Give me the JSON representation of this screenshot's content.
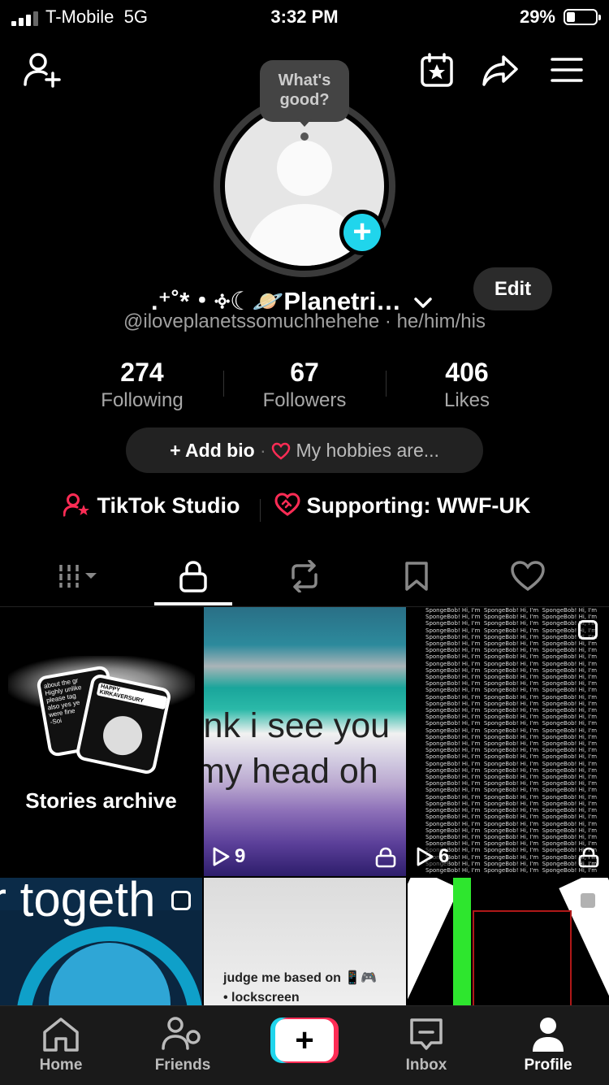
{
  "status_bar": {
    "carrier": "T-Mobile",
    "network": "5G",
    "time": "3:32 PM",
    "battery": "29%"
  },
  "bubble": {
    "line1": "What's",
    "line2": "good?"
  },
  "profile": {
    "display_name": ".⁺˚*・༓☾🪐Planetri…",
    "edit_label": "Edit",
    "handle": "@iloveplanetssomuchhehehe",
    "pronouns": "he/him/his",
    "stats": [
      {
        "value": "274",
        "label": "Following"
      },
      {
        "value": "67",
        "label": "Followers"
      },
      {
        "value": "406",
        "label": "Likes"
      }
    ],
    "add_bio": "Add bio",
    "hobbies": "My hobbies are...",
    "studio": "TikTok Studio",
    "supporting": "Supporting: WWF-UK"
  },
  "grid": {
    "stories_label": "Stories archive",
    "story_card_left_text": "about the gr\nHighly unlike\nplease tag\nalso yes ye\nwere fine\n-Soi",
    "story_card_right_text": "HAPPY KIRKAVERSURY",
    "video1_caption_line1": "ink i see you",
    "video1_caption_line2": "my head oh",
    "video1_views": "9",
    "video2_views": "6",
    "video2_text": "SpongeBob! Hi, I'm",
    "row2a_text": "r togeth",
    "row2b_line1": "judge me based on 📱🎮",
    "row2b_line2": "• lockscreen"
  },
  "nav": {
    "home": "Home",
    "friends": "Friends",
    "inbox": "Inbox",
    "profile": "Profile"
  },
  "colors": {
    "accent_cyan": "#20d5ec",
    "accent_pink": "#fe2c55",
    "background": "#000000"
  }
}
